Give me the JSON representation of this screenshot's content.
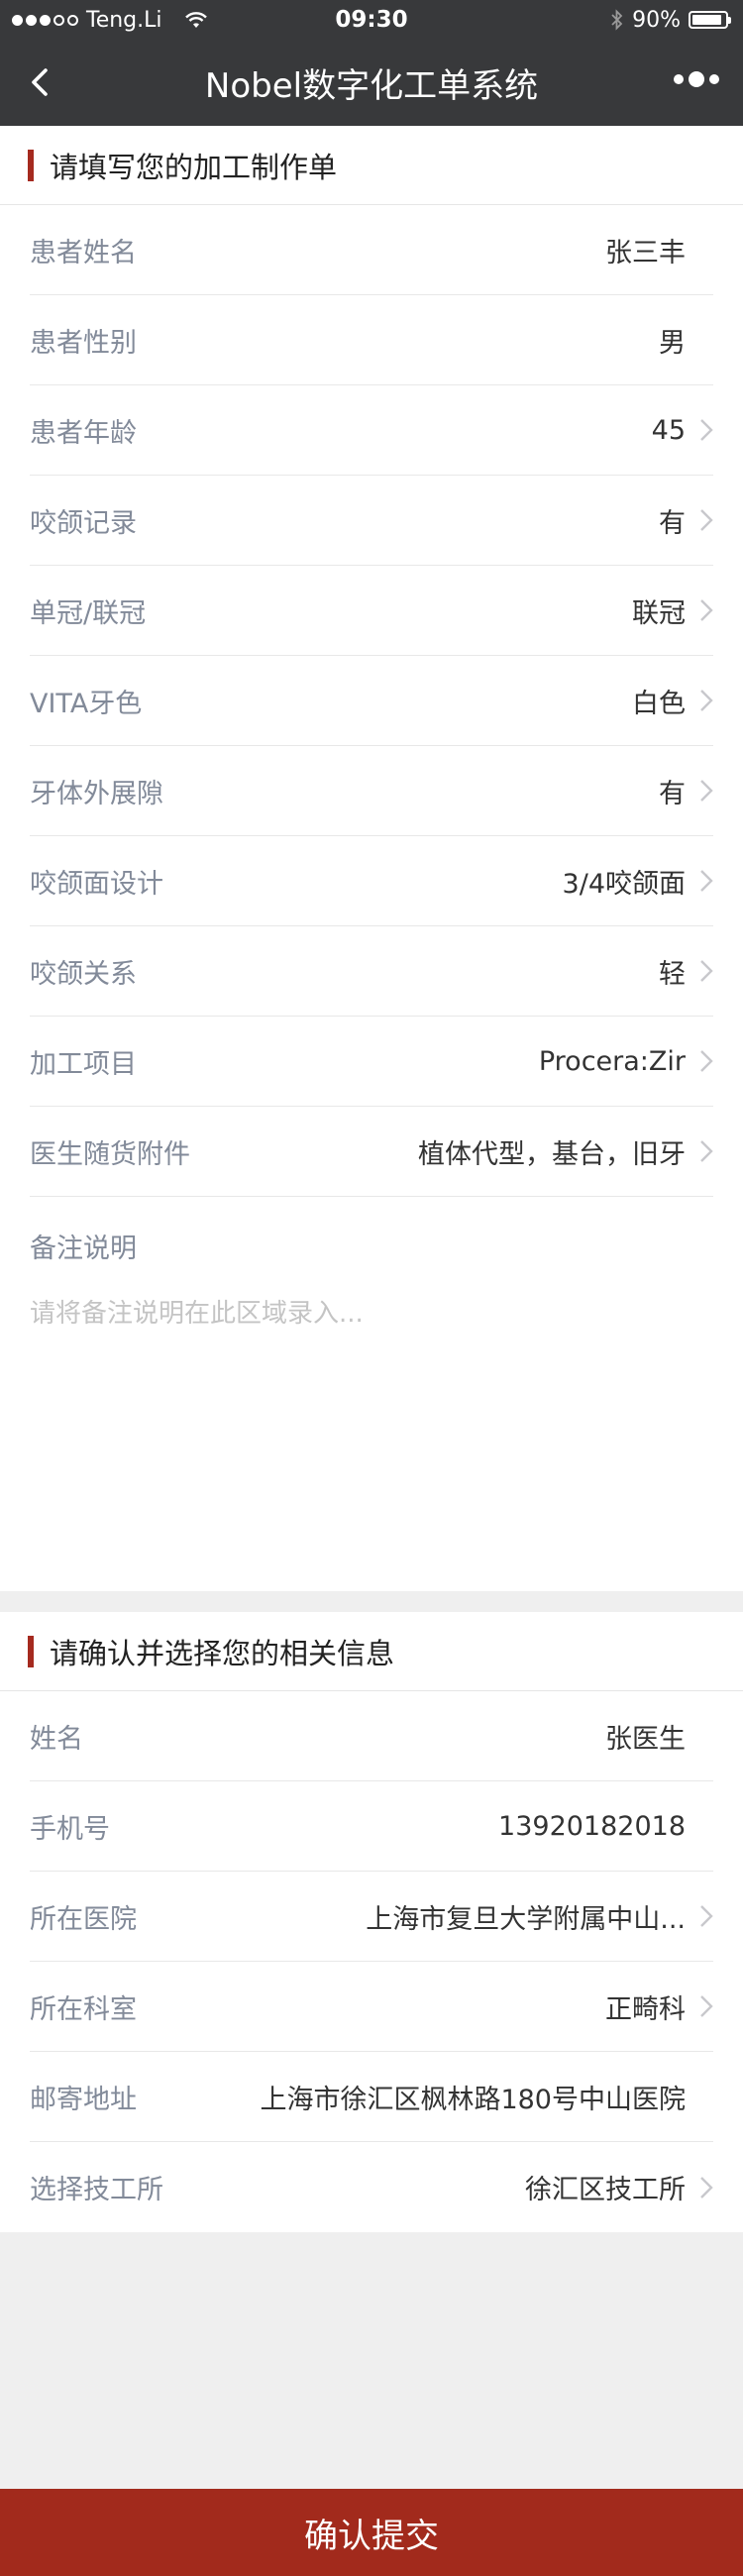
{
  "status_bar": {
    "carrier": "Teng.Li",
    "time": "09:30",
    "battery_percent": "90%",
    "battery_level": 0.9,
    "signal_bars_filled": 3,
    "signal_bars_total": 5
  },
  "nav": {
    "title": "Nobel数字化工单系统"
  },
  "order_section": {
    "title": "请填写您的加工制作单",
    "rows": [
      {
        "label": "患者姓名",
        "value": "张三丰",
        "chevron": false
      },
      {
        "label": "患者性别",
        "value": "男",
        "chevron": false
      },
      {
        "label": "患者年龄",
        "value": "45",
        "chevron": true
      },
      {
        "label": "咬颌记录",
        "value": "有",
        "chevron": true
      },
      {
        "label": "单冠/联冠",
        "value": "联冠",
        "chevron": true
      },
      {
        "label": "VITA牙色",
        "value": "白色",
        "chevron": true
      },
      {
        "label": "牙体外展隙",
        "value": "有",
        "chevron": true
      },
      {
        "label": "咬颌面设计",
        "value": "3/4咬颌面",
        "chevron": true
      },
      {
        "label": "咬颌关系",
        "value": "轻",
        "chevron": true
      },
      {
        "label": "加工项目",
        "value": "Procera:Zir",
        "chevron": true
      },
      {
        "label": "医生随货附件",
        "value": "植体代型，基台，旧牙",
        "chevron": true
      }
    ],
    "remarks": {
      "label": "备注说明",
      "placeholder": "请将备注说明在此区域录入...",
      "value": ""
    }
  },
  "info_section": {
    "title": "请确认并选择您的相关信息",
    "rows": [
      {
        "label": "姓名",
        "value": "张医生",
        "chevron": false
      },
      {
        "label": "手机号",
        "value": "13920182018",
        "chevron": false
      },
      {
        "label": "所在医院",
        "value": "上海市复旦大学附属中山...",
        "chevron": true
      },
      {
        "label": "所在科室",
        "value": "正畸科",
        "chevron": true
      },
      {
        "label": "邮寄地址",
        "value": "上海市徐汇区枫林路180号中山医院",
        "chevron": false
      },
      {
        "label": "选择技工所",
        "value": "徐汇区技工所",
        "chevron": true
      }
    ]
  },
  "submit": {
    "label": "确认提交"
  },
  "colors": {
    "header_bg": "#38393b",
    "accent": "#a52a1f",
    "submit_bg": "#a22a1c",
    "label_text": "#828a99"
  }
}
